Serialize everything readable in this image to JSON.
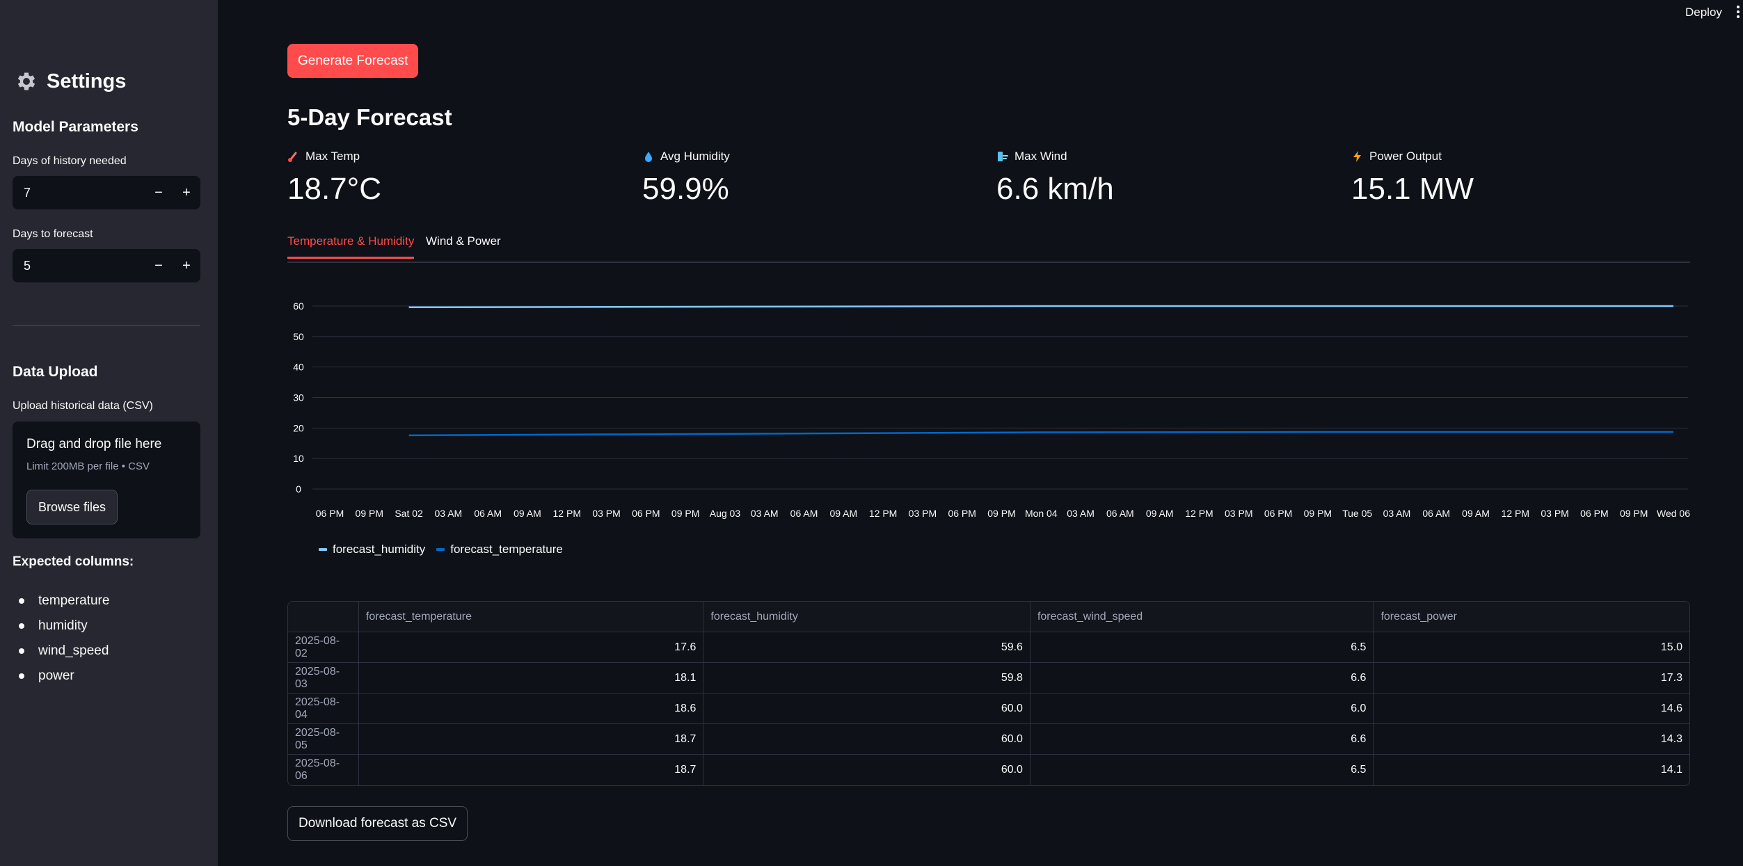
{
  "sidebar": {
    "title": "Settings",
    "model_params_heading": "Model Parameters",
    "history_label": "Days of history needed",
    "history_value": "7",
    "forecast_label": "Days to forecast",
    "forecast_value": "5",
    "minus": "−",
    "plus": "+",
    "upload_heading": "Data Upload",
    "upload_label": "Upload historical data (CSV)",
    "dropzone_main": "Drag and drop file here",
    "dropzone_sub": "Limit 200MB per file • CSV",
    "browse_label": "Browse files",
    "expected_heading": "Expected columns:",
    "expected_columns": [
      "temperature",
      "humidity",
      "wind_speed",
      "power"
    ]
  },
  "header": {
    "deploy_label": "Deploy"
  },
  "main": {
    "generate_label": "Generate Forecast",
    "heading": "5-Day Forecast",
    "metrics": [
      {
        "label": "Max Temp",
        "value": "18.7°C",
        "icon": "thermometer-icon"
      },
      {
        "label": "Avg Humidity",
        "value": "59.9%",
        "icon": "droplet-icon"
      },
      {
        "label": "Max Wind",
        "value": "6.6 km/h",
        "icon": "wind-icon"
      },
      {
        "label": "Power Output",
        "value": "15.1 MW",
        "icon": "lightning-icon"
      }
    ],
    "tabs": [
      "Temperature & Humidity",
      "Wind & Power"
    ],
    "download_label": "Download forecast as CSV"
  },
  "chart_data": {
    "type": "line",
    "x_tick_labels": [
      "06 PM",
      "09 PM",
      "Sat 02",
      "03 AM",
      "06 AM",
      "09 AM",
      "12 PM",
      "03 PM",
      "06 PM",
      "09 PM",
      "Aug 03",
      "03 AM",
      "06 AM",
      "09 AM",
      "12 PM",
      "03 PM",
      "06 PM",
      "09 PM",
      "Mon 04",
      "03 AM",
      "06 AM",
      "09 AM",
      "12 PM",
      "03 PM",
      "06 PM",
      "09 PM",
      "Tue 05",
      "03 AM",
      "06 AM",
      "09 AM",
      "12 PM",
      "03 PM",
      "06 PM",
      "09 PM",
      "Wed 06"
    ],
    "x": [
      "2025-08-02",
      "2025-08-03",
      "2025-08-04",
      "2025-08-05",
      "2025-08-06"
    ],
    "series": [
      {
        "name": "forecast_humidity",
        "values": [
          59.6,
          59.8,
          60.0,
          60.0,
          60.0
        ],
        "color": "#83c9ff"
      },
      {
        "name": "forecast_temperature",
        "values": [
          17.6,
          18.1,
          18.6,
          18.7,
          18.7
        ],
        "color": "#0068c9"
      }
    ],
    "y_ticks": [
      0,
      10,
      20,
      30,
      40,
      50,
      60
    ],
    "ylim": [
      0,
      60
    ],
    "grid": true,
    "legend_position": "bottom-left"
  },
  "table": {
    "columns": [
      "",
      "forecast_temperature",
      "forecast_humidity",
      "forecast_wind_speed",
      "forecast_power"
    ],
    "rows": [
      [
        "2025-08-02",
        "17.6",
        "59.6",
        "6.5",
        "15.0"
      ],
      [
        "2025-08-03",
        "18.1",
        "59.8",
        "6.6",
        "17.3"
      ],
      [
        "2025-08-04",
        "18.6",
        "60.0",
        "6.0",
        "14.6"
      ],
      [
        "2025-08-05",
        "18.7",
        "60.0",
        "6.6",
        "14.3"
      ],
      [
        "2025-08-06",
        "18.7",
        "60.0",
        "6.5",
        "14.1"
      ]
    ]
  },
  "colors": {
    "accent": "#ff4b4b",
    "background": "#0e1117",
    "sidebar": "#262730"
  }
}
